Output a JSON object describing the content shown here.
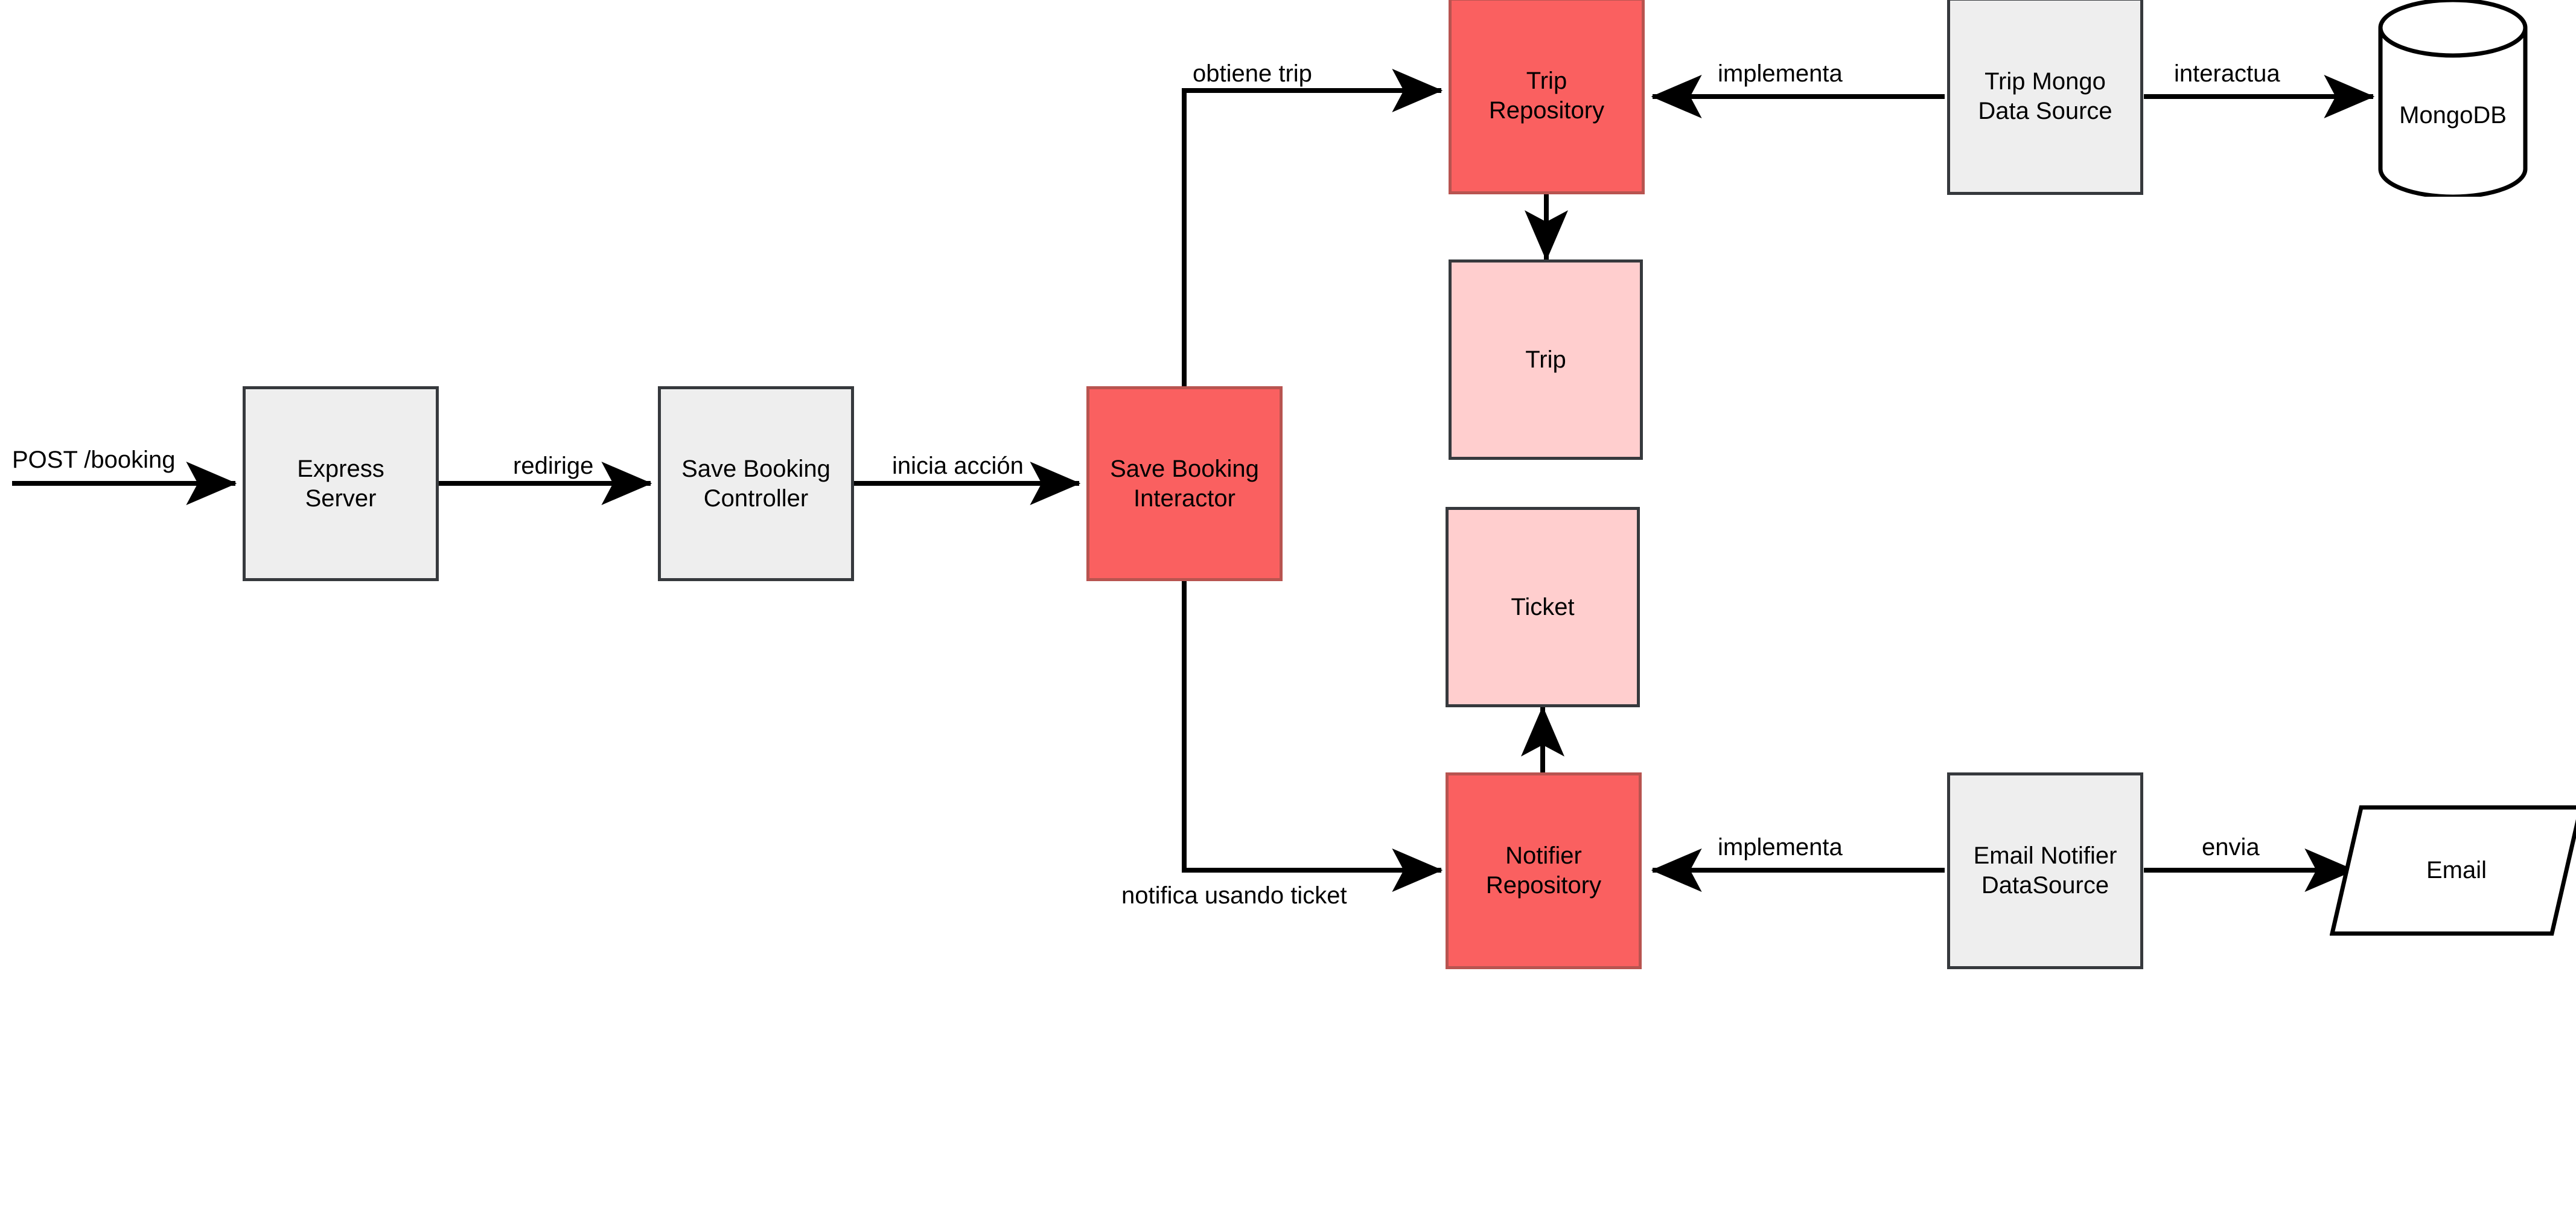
{
  "diagram": {
    "title": "Clean Architecture booking flow diagram",
    "colors": {
      "gray_fill": "#eeeeee",
      "gray_stroke": "#36393d",
      "red_fill": "#fa6060",
      "red_stroke": "#b85450",
      "pink_fill": "#ffcece",
      "pink_stroke": "#36393d",
      "white_fill": "#ffffff",
      "edge_stroke": "#000000"
    },
    "nodes": [
      {
        "id": "express_server",
        "label": "Express\nServer",
        "shape": "rectangle",
        "style": "gray"
      },
      {
        "id": "save_booking_controller",
        "label": "Save Booking\nController",
        "shape": "rectangle",
        "style": "gray"
      },
      {
        "id": "save_booking_interactor",
        "label": "Save Booking\nInteractor",
        "shape": "rectangle",
        "style": "red"
      },
      {
        "id": "trip_repository",
        "label": "Trip\nRepository",
        "shape": "rectangle",
        "style": "red"
      },
      {
        "id": "trip",
        "label": "Trip",
        "shape": "rectangle",
        "style": "pink"
      },
      {
        "id": "ticket",
        "label": "Ticket",
        "shape": "rectangle",
        "style": "pink"
      },
      {
        "id": "notifier_repository",
        "label": "Notifier\nRepository",
        "shape": "rectangle",
        "style": "red"
      },
      {
        "id": "trip_mongo_data_source",
        "label": "Trip Mongo\nData Source",
        "shape": "rectangle",
        "style": "gray"
      },
      {
        "id": "email_notifier_datasource",
        "label": "Email Notifier\nDataSource",
        "shape": "rectangle",
        "style": "gray"
      },
      {
        "id": "mongodb",
        "label": "MongoDB",
        "shape": "cylinder",
        "style": "white"
      },
      {
        "id": "email",
        "label": "Email",
        "shape": "parallelogram",
        "style": "white"
      }
    ],
    "edges": [
      {
        "id": "e_request",
        "label": "POST /booking",
        "from": "external",
        "to": "express_server"
      },
      {
        "id": "e_redirige",
        "label": "redirige",
        "from": "express_server",
        "to": "save_booking_controller"
      },
      {
        "id": "e_inicia",
        "label": "inicia acción",
        "from": "save_booking_controller",
        "to": "save_booking_interactor"
      },
      {
        "id": "e_obtiene",
        "label": "obtiene trip",
        "from": "save_booking_interactor",
        "to": "trip_repository"
      },
      {
        "id": "e_notifica",
        "label": "notifica usando ticket",
        "from": "save_booking_interactor",
        "to": "notifier_repository"
      },
      {
        "id": "e_trip_out",
        "label": "",
        "from": "trip_repository",
        "to": "trip"
      },
      {
        "id": "e_ticket_out",
        "label": "",
        "from": "notifier_repository",
        "to": "ticket"
      },
      {
        "id": "e_impl_trip",
        "label": "implementa",
        "from": "trip_mongo_data_source",
        "to": "trip_repository"
      },
      {
        "id": "e_interactua",
        "label": "interactua",
        "from": "trip_mongo_data_source",
        "to": "mongodb"
      },
      {
        "id": "e_impl_notif",
        "label": "implementa",
        "from": "email_notifier_datasource",
        "to": "notifier_repository"
      },
      {
        "id": "e_envia",
        "label": "envia",
        "from": "email_notifier_datasource",
        "to": "email"
      }
    ]
  }
}
